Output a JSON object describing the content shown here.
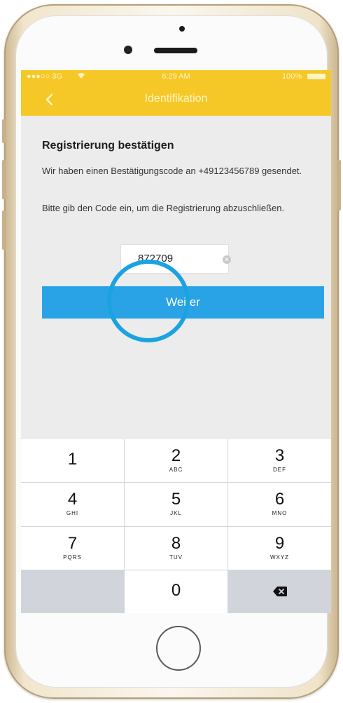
{
  "status_bar": {
    "carrier": "●●●○○ 3G",
    "wifi_icon": "wifi-icon",
    "time": "6:29 AM",
    "battery": "100%"
  },
  "nav": {
    "back_icon": "chevron-left-icon",
    "title": "Identifikation"
  },
  "content": {
    "heading": "Registrierung bestätigen",
    "sent_text": "Wir haben einen Bestätigungscode an +49123456789 gesendet.",
    "instruction": "Bitte gib den Code ein, um die Registrierung abzuschließen.",
    "code_value": "872709",
    "continue_label": "Weiter"
  },
  "keypad": {
    "keys": [
      {
        "digit": "1",
        "letters": ""
      },
      {
        "digit": "2",
        "letters": "ABC"
      },
      {
        "digit": "3",
        "letters": "DEF"
      },
      {
        "digit": "4",
        "letters": "GHI"
      },
      {
        "digit": "5",
        "letters": "JKL"
      },
      {
        "digit": "6",
        "letters": "MNO"
      },
      {
        "digit": "7",
        "letters": "PQRS"
      },
      {
        "digit": "8",
        "letters": "TUV"
      },
      {
        "digit": "9",
        "letters": "WXYZ"
      },
      {
        "digit": "0",
        "letters": ""
      }
    ]
  },
  "colors": {
    "accent_yellow": "#f6c827",
    "button_blue": "#2aa3e6",
    "highlight_ring": "#1aa3e0"
  }
}
